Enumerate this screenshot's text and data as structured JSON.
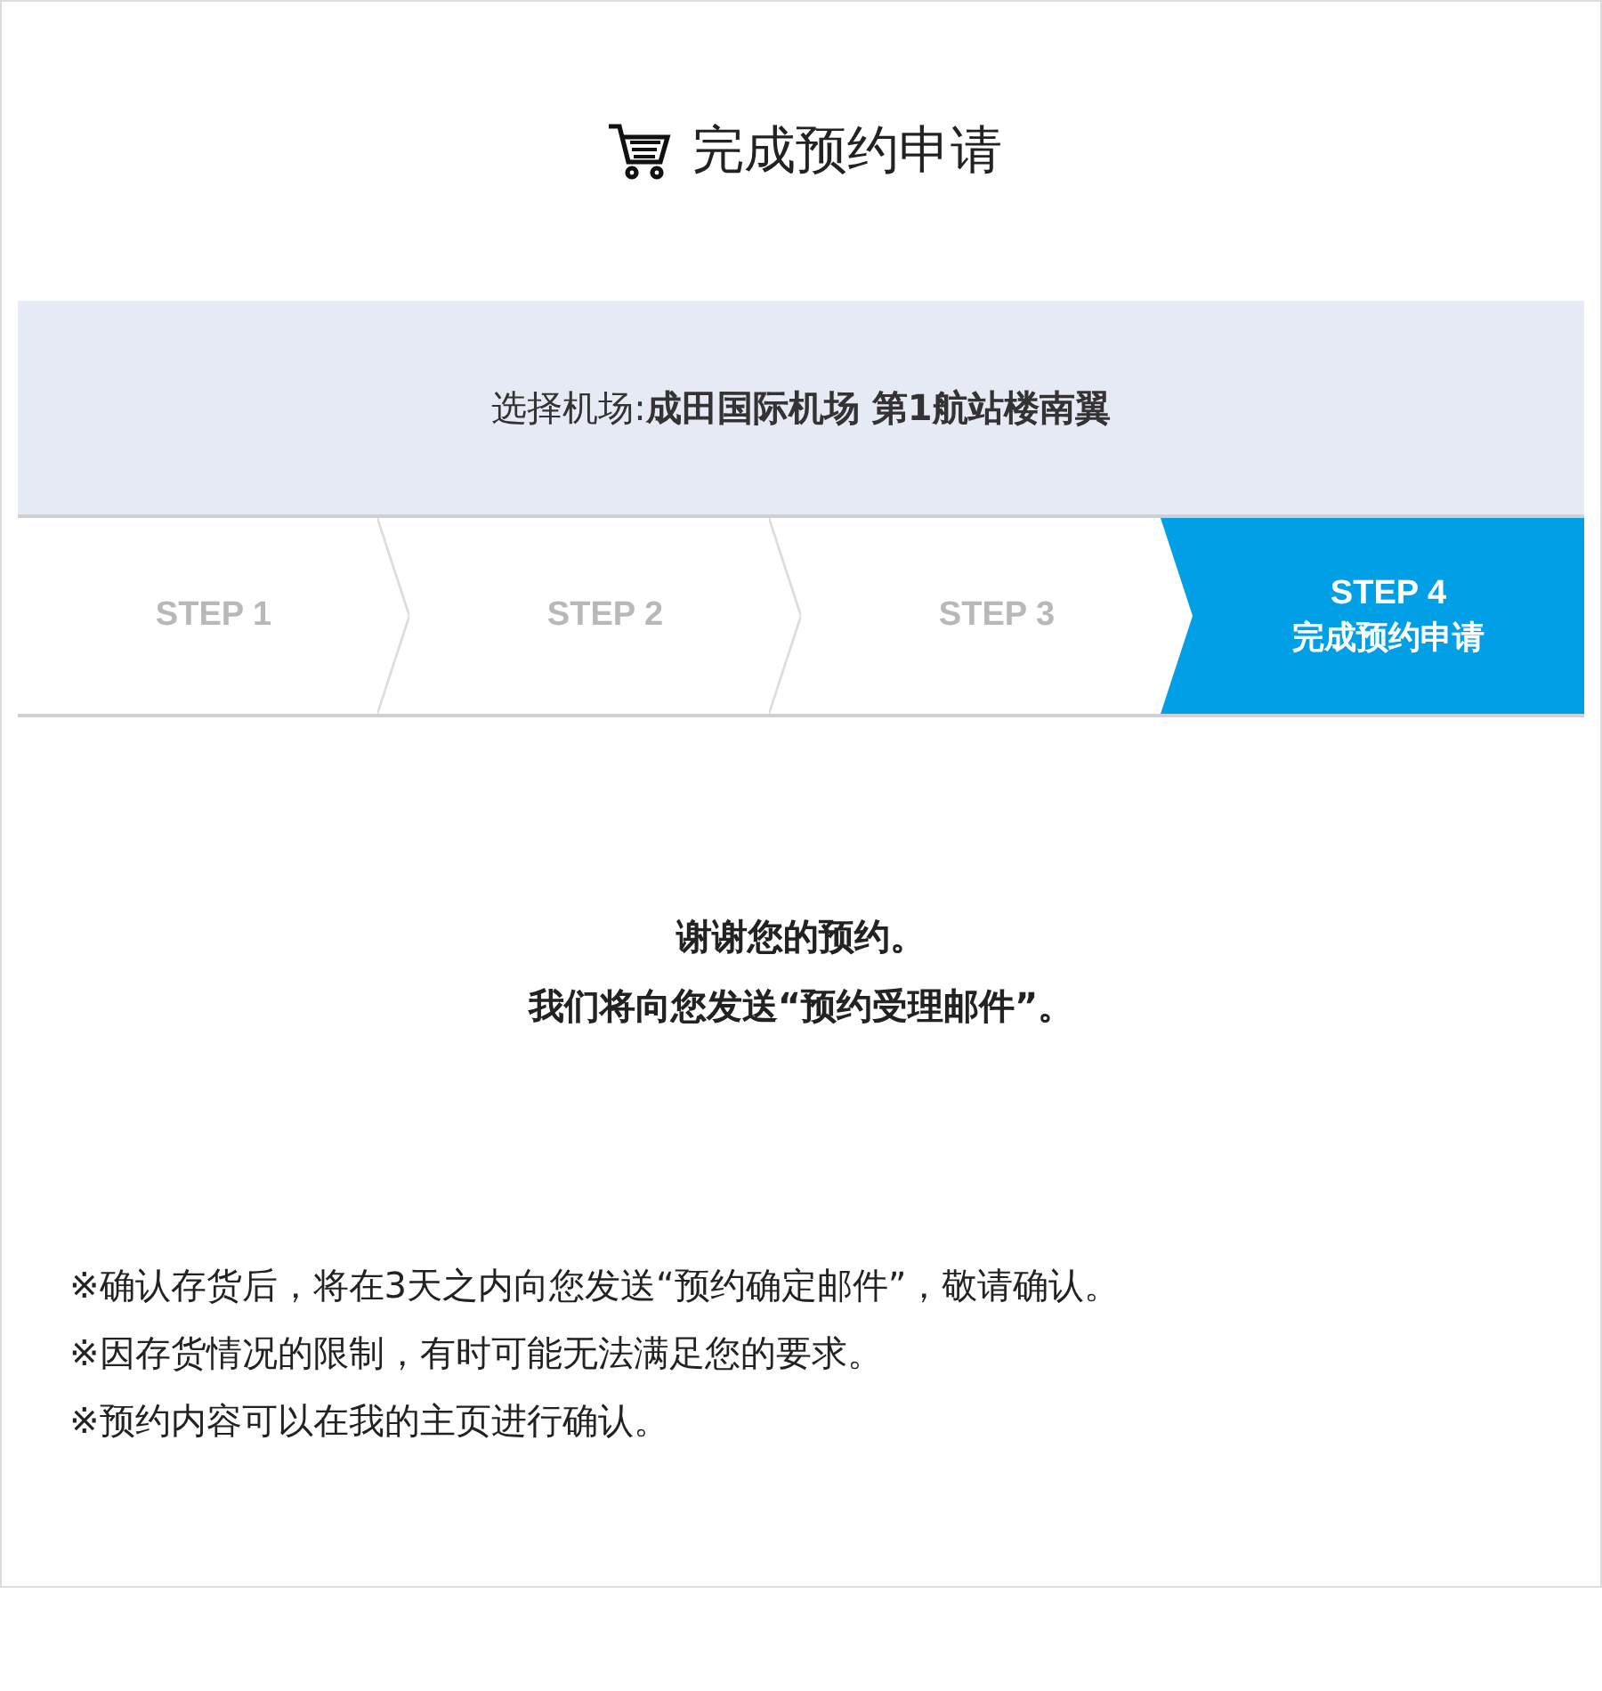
{
  "title": "完成预约申请",
  "airport": "选择机场:**成田国际机场 第1航站楼南翼**",
  "steps": [
    {
      "label": "STEP 1",
      "selected": false
    },
    {
      "label": "STEP 2",
      "selected": false
    },
    {
      "label": "STEP 3",
      "selected": false
    },
    {
      "label": "STEP 4",
      "sublabel": "完成预约申请",
      "selected": true
    }
  ],
  "thanks": [
    "谢谢您的预约。",
    "我们将向您发送“预约受理邮件”。"
  ],
  "notes": [
    "※确认存货后，将在3天之内向您发送“预约确定邮件”，敬请确认。",
    "※因存货情况的限制，有时可能无法满足您的要求。",
    "※预约内容可以在我的主页进行确认。"
  ]
}
